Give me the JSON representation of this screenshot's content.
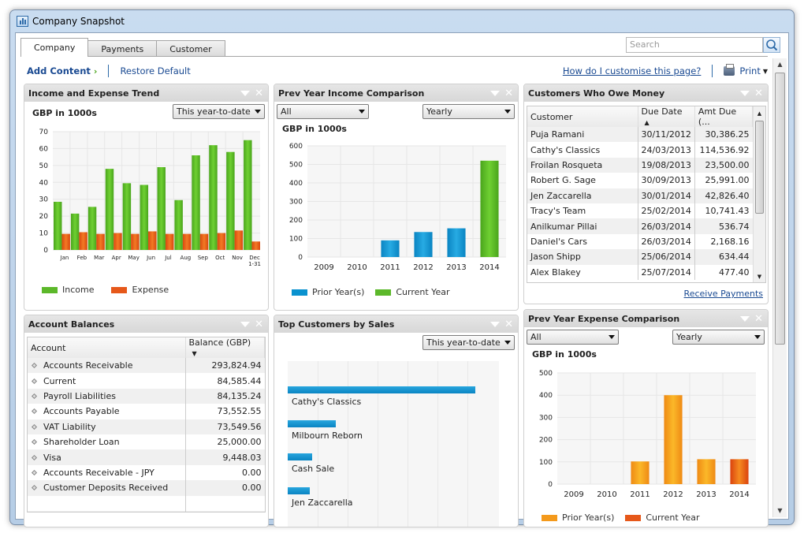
{
  "window": {
    "title": "Company Snapshot"
  },
  "tabs": [
    {
      "label": "Company",
      "active": true
    },
    {
      "label": "Payments"
    },
    {
      "label": "Customer"
    }
  ],
  "search": {
    "placeholder": "Search"
  },
  "toolbar": {
    "add_content": "Add Content",
    "restore_default": "Restore Default",
    "help_link": "How do I customise this page?",
    "print": "Print"
  },
  "colors": {
    "income": "#5cb82a",
    "expense": "#e6581a",
    "prior_income": "#0a92cf",
    "current_income": "#5cb82a",
    "prior_expense": "#f49a1c",
    "current_expense": "#e6581a",
    "link": "#1a4a92"
  },
  "panels": {
    "income_expense": {
      "title": "Income and Expense Trend",
      "period": "This year-to-date",
      "unit_label": "GBP in 1000s",
      "legend": [
        "Income",
        "Expense"
      ]
    },
    "prev_income": {
      "title": "Prev Year Income Comparison",
      "filter": "All",
      "period": "Yearly",
      "unit_label": "GBP in 1000s",
      "legend": [
        "Prior Year(s)",
        "Current Year"
      ]
    },
    "owe_money": {
      "title": "Customers Who Owe Money",
      "columns": [
        "Customer",
        "Due Date",
        "Amt Due (..."
      ],
      "rows": [
        [
          "Puja Ramani",
          "30/11/2012",
          "30,386.25"
        ],
        [
          "Cathy's Classics",
          "24/03/2013",
          "114,536.92"
        ],
        [
          "Froilan Rosqueta",
          "19/08/2013",
          "23,500.00"
        ],
        [
          "Robert G. Sage",
          "30/09/2013",
          "25,991.00"
        ],
        [
          "Jen Zaccarella",
          "30/01/2014",
          "42,826.40"
        ],
        [
          "Tracy's Team",
          "25/02/2014",
          "10,741.43"
        ],
        [
          "Anilkumar Pillai",
          "26/03/2014",
          "536.74"
        ],
        [
          "Daniel's Cars",
          "26/03/2014",
          "2,168.16"
        ],
        [
          "Jason Shipp",
          "25/06/2014",
          "634.44"
        ],
        [
          "Alex Blakey",
          "25/07/2014",
          "477.40"
        ]
      ],
      "action_link": "Receive Payments"
    },
    "account_balances": {
      "title": "Account Balances",
      "columns": [
        "Account",
        "Balance (GBP)"
      ],
      "rows": [
        [
          "Accounts Receivable",
          "293,824.94"
        ],
        [
          "Current",
          "84,585.44"
        ],
        [
          "Payroll Liabilities",
          "84,135.24"
        ],
        [
          "Accounts Payable",
          "73,552.55"
        ],
        [
          "VAT Liability",
          "73,549.56"
        ],
        [
          "Shareholder Loan",
          "25,000.00"
        ],
        [
          "Visa",
          "9,448.03"
        ],
        [
          "Accounts Receivable - JPY",
          "0.00"
        ],
        [
          "Customer Deposits Received",
          "0.00"
        ]
      ]
    },
    "top_customers": {
      "title": "Top Customers by Sales",
      "period": "This year-to-date"
    },
    "prev_expense": {
      "title": "Prev Year Expense Comparison",
      "filter": "All",
      "period": "Yearly",
      "unit_label": "GBP in 1000s",
      "legend": [
        "Prior Year(s)",
        "Current Year"
      ]
    }
  },
  "chart_data": [
    {
      "id": "income_expense",
      "type": "bar",
      "title": "Income and Expense Trend",
      "ylabel": "GBP in 1000s",
      "categories": [
        "Jan",
        "Feb",
        "Mar",
        "Apr",
        "May",
        "Jun",
        "Jul",
        "Aug",
        "Sep",
        "Oct",
        "Nov",
        "Dec 1-31"
      ],
      "series": [
        {
          "name": "Income",
          "values": [
            28.5,
            21.5,
            25.5,
            48,
            39.5,
            38.5,
            49,
            29.5,
            56,
            62,
            58,
            65
          ]
        },
        {
          "name": "Expense",
          "values": [
            9.5,
            10.5,
            9.5,
            10,
            9.5,
            11,
            9.5,
            9.5,
            9.5,
            10,
            11.5,
            5
          ]
        }
      ],
      "yticks": [
        0,
        10,
        20,
        30,
        40,
        50,
        60,
        70
      ],
      "ylim": [
        0,
        70
      ],
      "grid": true,
      "legend": "bottom-left"
    },
    {
      "id": "prev_income",
      "type": "bar",
      "title": "Prev Year Income Comparison",
      "ylabel": "GBP in 1000s",
      "categories": [
        "2009",
        "2010",
        "2011",
        "2012",
        "2013",
        "2014"
      ],
      "series": [
        {
          "name": "Prior Year(s)",
          "values": [
            0,
            0,
            90,
            135,
            155,
            null
          ]
        },
        {
          "name": "Current Year",
          "values": [
            null,
            null,
            null,
            null,
            null,
            520
          ]
        }
      ],
      "yticks": [
        0,
        100,
        200,
        300,
        400,
        500,
        600
      ],
      "ylim": [
        0,
        600
      ],
      "grid": true,
      "legend": "bottom-left"
    },
    {
      "id": "top_customers",
      "type": "bar",
      "orientation": "horizontal",
      "title": "Top Customers by Sales",
      "categories": [
        "Cathy's Classics",
        "Milbourn Reborn",
        "Cash Sale",
        "Jen Zaccarella"
      ],
      "values": [
        100,
        25.5,
        13,
        11.8
      ],
      "xlim": [
        0,
        120
      ],
      "grid": true
    },
    {
      "id": "prev_expense",
      "type": "bar",
      "title": "Prev Year Expense Comparison",
      "ylabel": "GBP in 1000s",
      "categories": [
        "2009",
        "2010",
        "2011",
        "2012",
        "2013",
        "2014"
      ],
      "series": [
        {
          "name": "Prior Year(s)",
          "values": [
            0,
            0,
            102,
            400,
            112,
            null
          ]
        },
        {
          "name": "Current Year",
          "values": [
            null,
            null,
            null,
            null,
            null,
            112
          ]
        }
      ],
      "yticks": [
        0,
        100,
        200,
        300,
        400,
        500
      ],
      "ylim": [
        0,
        500
      ],
      "grid": true,
      "legend": "bottom-left"
    }
  ]
}
